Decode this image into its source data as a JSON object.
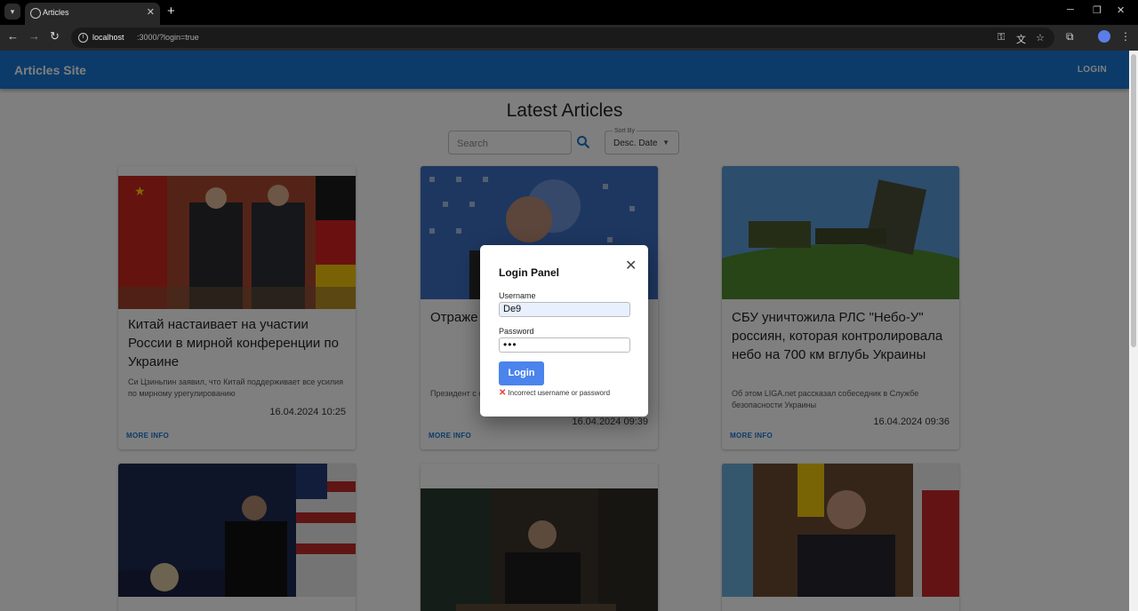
{
  "browser": {
    "tab_title": "Articles",
    "url_host": "localhost",
    "url_rest": ":3000/?login=true"
  },
  "site": {
    "title": "Articles Site",
    "login_link": "LOGIN",
    "brand_color": "#1976d2"
  },
  "main": {
    "heading": "Latest Articles",
    "search_placeholder": "Search",
    "sort_label": "Sort By",
    "sort_value": "Desc. Date"
  },
  "articles": [
    {
      "title": "Китай настаивает на участии России в мирной конференции по Украине",
      "description": "Си Цзиньпин заявил, что Китай поддерживает все усилия по мирному урегулированию",
      "date": "16.04.2024 10:25",
      "more": "MORE INFO"
    },
    {
      "title": "Отраже Зеленск что тако бумаге",
      "description": "Президент с самостоятел",
      "date": "16.04.2024 09:39",
      "more": "MORE INFO"
    },
    {
      "title": "СБУ уничтожила РЛС \"Небо-У\" россиян, которая контролировала небо на 700 км вглубь Украины",
      "description": "Об этом LIGA.net рассказал собеседник в Службе безопасности Украины",
      "date": "16.04.2024 09:36",
      "more": "MORE INFO"
    }
  ],
  "modal": {
    "title": "Login Panel",
    "username_label": "Username",
    "username_value": "De9",
    "password_label": "Password",
    "password_value": "•••",
    "login_button": "Login",
    "error_text": "Incorrect username or password"
  }
}
